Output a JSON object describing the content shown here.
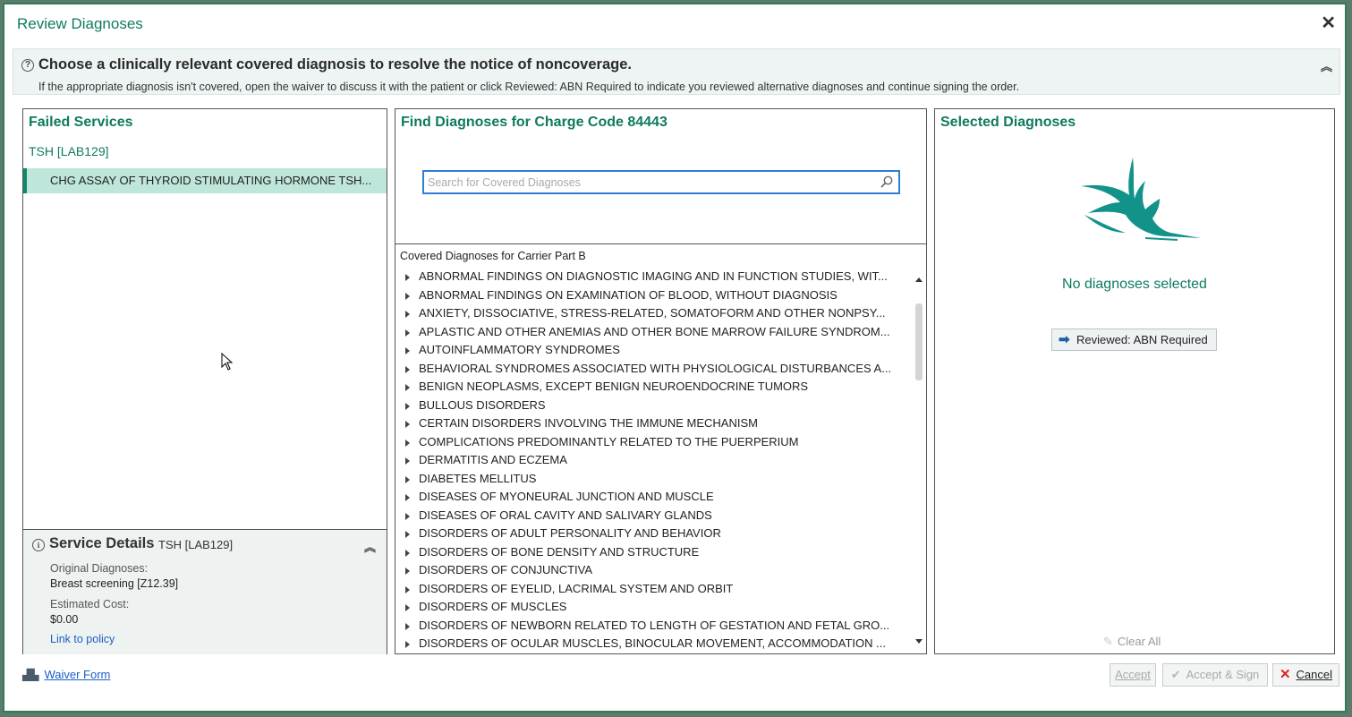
{
  "dialog": {
    "title": "Review Diagnoses",
    "close_icon": "close-icon"
  },
  "banner": {
    "headline": "Choose a clinically relevant covered diagnosis to resolve the notice of noncoverage.",
    "subtext": "If the appropriate diagnosis isn't covered, open the waiver to discuss it with the patient or click Reviewed: ABN Required to indicate you reviewed alternative diagnoses and continue signing the order."
  },
  "failed_services": {
    "title": "Failed Services",
    "group": "TSH [LAB129]",
    "items": [
      "CHG ASSAY OF THYROID STIMULATING HORMONE TSH..."
    ]
  },
  "service_details": {
    "title": "Service Details",
    "code": "TSH [LAB129]",
    "original_label": "Original Diagnoses:",
    "original_value": "Breast screening [Z12.39]",
    "cost_label": "Estimated Cost:",
    "cost_value": "$0.00",
    "link": "Link to policy"
  },
  "find": {
    "title": "Find Diagnoses for Charge Code 84443",
    "search_placeholder": "Search for Covered Diagnoses",
    "list_caption": "Covered Diagnoses for Carrier Part B",
    "items": [
      "ABNORMAL FINDINGS ON DIAGNOSTIC IMAGING AND IN FUNCTION STUDIES, WIT...",
      "ABNORMAL FINDINGS ON EXAMINATION OF BLOOD, WITHOUT DIAGNOSIS",
      "ANXIETY, DISSOCIATIVE, STRESS-RELATED, SOMATOFORM AND OTHER NONPSY...",
      "APLASTIC AND OTHER ANEMIAS AND OTHER BONE MARROW FAILURE SYNDROM...",
      "AUTOINFLAMMATORY SYNDROMES",
      "BEHAVIORAL SYNDROMES ASSOCIATED WITH PHYSIOLOGICAL DISTURBANCES A...",
      "BENIGN NEOPLASMS, EXCEPT BENIGN NEUROENDOCRINE TUMORS",
      "BULLOUS DISORDERS",
      "CERTAIN DISORDERS INVOLVING THE IMMUNE MECHANISM",
      "COMPLICATIONS PREDOMINANTLY RELATED TO THE PUERPERIUM",
      "DERMATITIS AND ECZEMA",
      "DIABETES MELLITUS",
      "DISEASES OF MYONEURAL JUNCTION AND MUSCLE",
      "DISEASES OF ORAL CAVITY AND SALIVARY GLANDS",
      "DISORDERS OF ADULT PERSONALITY AND BEHAVIOR",
      "DISORDERS OF BONE DENSITY AND STRUCTURE",
      "DISORDERS OF CONJUNCTIVA",
      "DISORDERS OF EYELID, LACRIMAL SYSTEM AND ORBIT",
      "DISORDERS OF MUSCLES",
      "DISORDERS OF NEWBORN RELATED TO LENGTH OF GESTATION AND FETAL GRO...",
      "DISORDERS OF OCULAR MUSCLES, BINOCULAR MOVEMENT, ACCOMMODATION ..."
    ]
  },
  "selected": {
    "title": "Selected Diagnoses",
    "empty_text": "No diagnoses selected",
    "abn_button": "Reviewed: ABN Required",
    "clear_all": "Clear All"
  },
  "footer": {
    "waiver": "Waiver Form",
    "accept": "Accept",
    "accept_sign": "Accept & Sign",
    "cancel": "Cancel"
  },
  "colors": {
    "accent": "#0e7a5f",
    "selection": "#bfe6da",
    "link": "#1a5fc8"
  }
}
